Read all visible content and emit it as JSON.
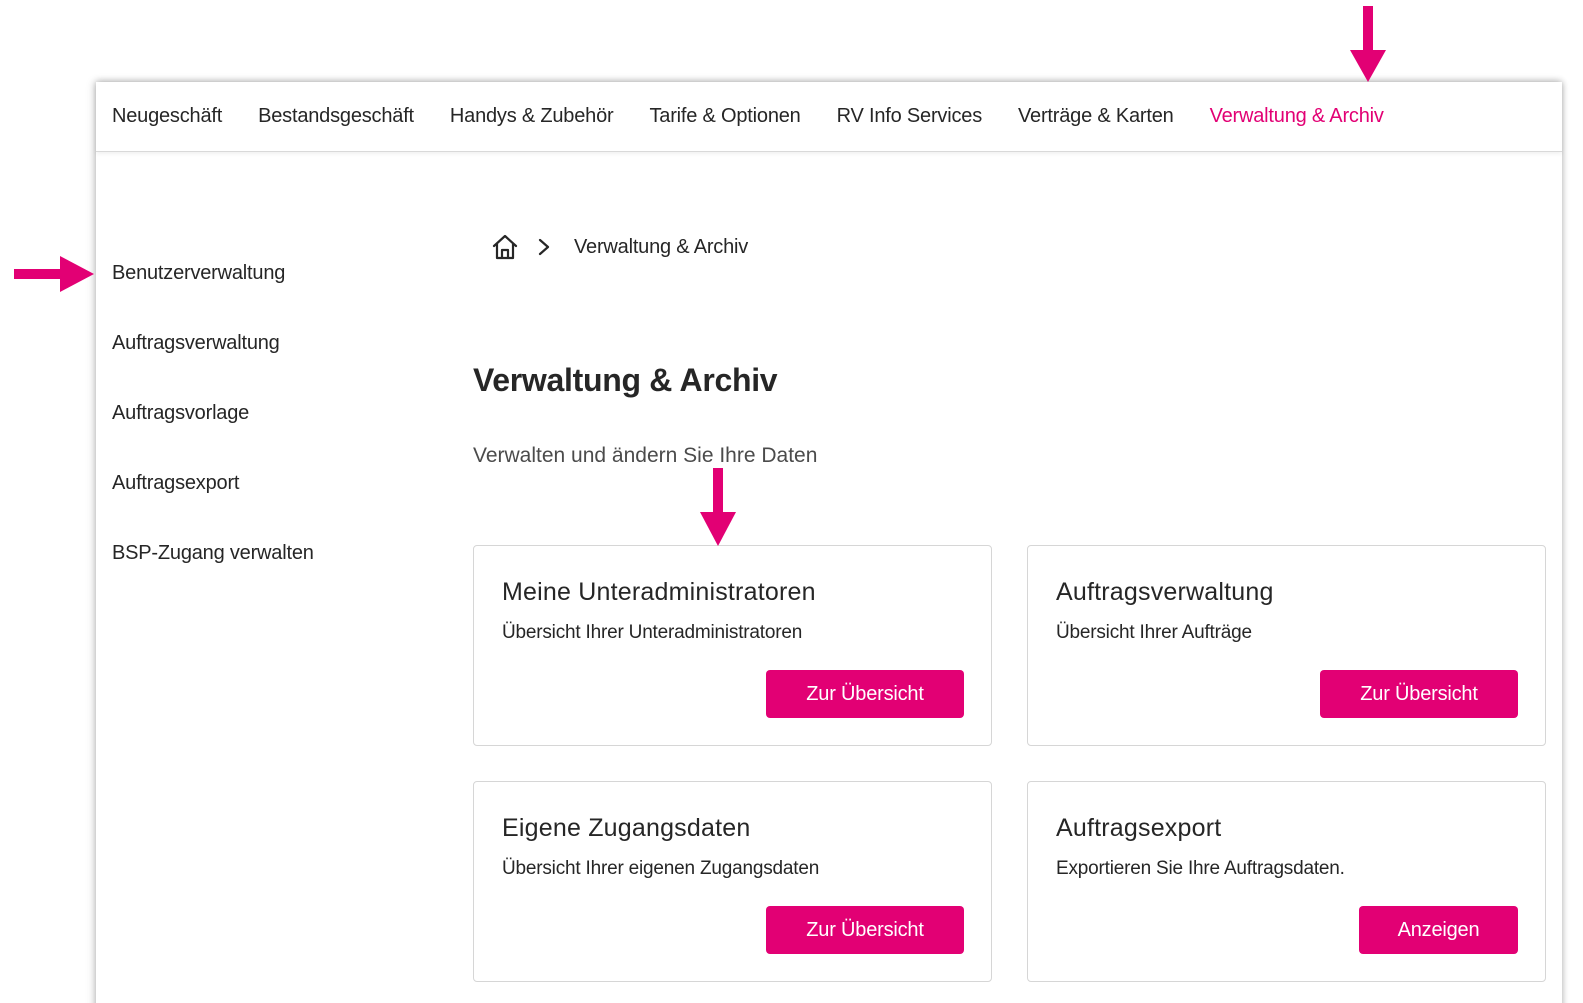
{
  "topnav": {
    "items": [
      {
        "label": "Neugeschäft",
        "active": false
      },
      {
        "label": "Bestandsgeschäft",
        "active": false
      },
      {
        "label": "Handys & Zubehör",
        "active": false
      },
      {
        "label": "Tarife & Optionen",
        "active": false
      },
      {
        "label": "RV Info Services",
        "active": false
      },
      {
        "label": "Verträge & Karten",
        "active": false
      },
      {
        "label": "Verwaltung & Archiv",
        "active": true
      }
    ]
  },
  "sidebar": {
    "items": [
      {
        "label": "Benutzerverwaltung"
      },
      {
        "label": "Auftragsverwaltung"
      },
      {
        "label": "Auftragsvorlage"
      },
      {
        "label": "Auftragsexport"
      },
      {
        "label": "BSP-Zugang verwalten"
      }
    ]
  },
  "breadcrumb": {
    "home_icon": "home-icon",
    "separator_icon": "chevron-right-icon",
    "current": "Verwaltung & Archiv"
  },
  "main": {
    "title": "Verwaltung & Archiv",
    "subtitle": "Verwalten und ändern Sie Ihre Daten",
    "cards": [
      {
        "title": "Meine Unteradministratoren",
        "desc": "Übersicht Ihrer Unteradministratoren",
        "button": "Zur Übersicht"
      },
      {
        "title": "Auftragsverwaltung",
        "desc": "Übersicht Ihrer Aufträge",
        "button": "Zur Übersicht"
      },
      {
        "title": "Eigene Zugangsdaten",
        "desc": "Übersicht Ihrer eigenen Zugangsdaten",
        "button": "Zur Übersicht"
      },
      {
        "title": "Auftragsexport",
        "desc": "Exportieren Sie Ihre Auftragsdaten.",
        "button": "Anzeigen"
      }
    ]
  },
  "colors": {
    "accent": "#e20074",
    "text": "#262626",
    "border": "#d6d6d6"
  }
}
